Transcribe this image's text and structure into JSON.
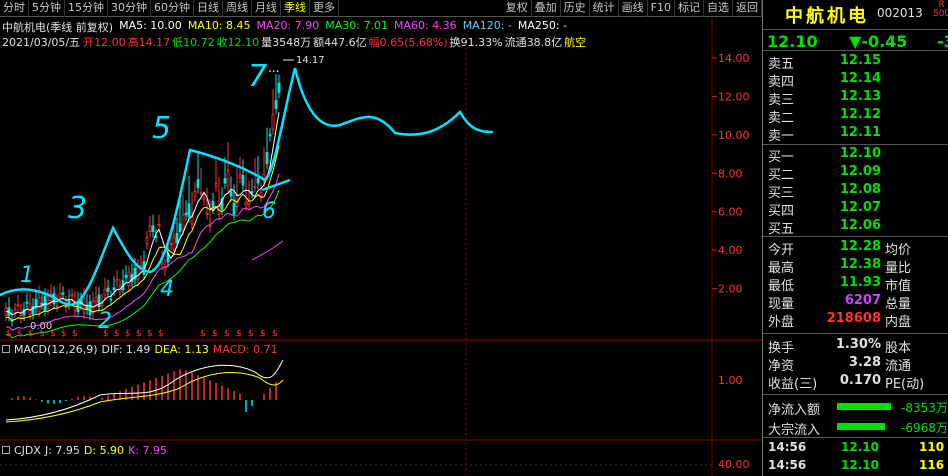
{
  "toolbar": {
    "left": [
      "分时",
      "5分钟",
      "15分钟",
      "30分钟",
      "60分钟",
      "日线",
      "周线",
      "月线",
      "季线",
      "更多"
    ],
    "active": "季线",
    "right": [
      "复权",
      "叠加",
      "历史",
      "统计",
      "画线",
      "F10",
      "标记",
      "自选",
      "返回"
    ]
  },
  "info": {
    "name_mode": "中航机电(季线 前复权)",
    "ma": [
      {
        "label": "MA5: 10.00",
        "color": "#ffffff"
      },
      {
        "label": "MA10: 8.45",
        "color": "#ffff00"
      },
      {
        "label": "MA20: 7.90",
        "color": "#ff44ff"
      },
      {
        "label": "MA30: 7.01",
        "color": "#00ff00"
      },
      {
        "label": "MA60: 4.36",
        "color": "#ff40ff"
      },
      {
        "label": "MA120: -",
        "color": "#66ccff"
      },
      {
        "label": "MA250: -",
        "color": "#ffffff"
      }
    ],
    "date": "2021/03/05/五",
    "fields": [
      {
        "label": "开",
        "value": "12.00",
        "label_color": "#ff3333",
        "value_color": "#ff3333"
      },
      {
        "label": "高",
        "value": "14.17",
        "label_color": "#ff3333",
        "value_color": "#ff3333"
      },
      {
        "label": "低",
        "value": "10.72",
        "label_color": "#00e000",
        "value_color": "#00e000"
      },
      {
        "label": "收",
        "value": "12.10",
        "label_color": "#00e000",
        "value_color": "#00e000"
      },
      {
        "label": "量",
        "value": "3548万",
        "label_color": "#e0e0e0",
        "value_color": "#e0e0e0"
      },
      {
        "label": "额",
        "value": "447.6亿",
        "label_color": "#e0e0e0",
        "value_color": "#e0e0e0"
      },
      {
        "label": "幅",
        "value": "0.65(5.68%)",
        "label_color": "#ff3333",
        "value_color": "#ff3333"
      },
      {
        "label": "换",
        "value": "91.33%",
        "label_color": "#e0e0e0",
        "value_color": "#e0e0e0"
      },
      {
        "label": "流通",
        "value": "38.8亿",
        "label_color": "#e0e0e0",
        "value_color": "#e0e0e0"
      },
      {
        "label": "",
        "value": "航空",
        "label_color": "#ffff00",
        "value_color": "#ffff00"
      }
    ]
  },
  "chart": {
    "high_label": "14.17",
    "low_label": "0.00",
    "y_ticks": [
      "14.00",
      "12.00",
      "10.00",
      "8.00",
      "6.00",
      "4.00",
      "2.00"
    ],
    "annotations": [
      "1",
      "2",
      "3",
      "4",
      "5",
      "6",
      "7"
    ]
  },
  "macd": {
    "name": "MACD(12,26,9)",
    "dif": "DIF: 1.49",
    "dea": "DEA: 1.13",
    "macd": "MACD: 0.71",
    "tick": "1.00"
  },
  "cjdx": {
    "name": "CJDX",
    "j": "J: 7.95",
    "d": "D: 5.90",
    "k": "K: 7.95",
    "tick": "40.00"
  },
  "quote": {
    "name": "中航机电",
    "code": "002013",
    "badge_r": "R",
    "badge_n": "500",
    "price": "12.10",
    "change": "▼-0.45",
    "change_pct": "-3",
    "asks": [
      {
        "label": "卖五",
        "price": "12.15"
      },
      {
        "label": "卖四",
        "price": "12.14"
      },
      {
        "label": "卖三",
        "price": "12.13"
      },
      {
        "label": "卖二",
        "price": "12.12"
      },
      {
        "label": "卖一",
        "price": "12.11"
      }
    ],
    "bids": [
      {
        "label": "买一",
        "price": "12.10"
      },
      {
        "label": "买二",
        "price": "12.09"
      },
      {
        "label": "买三",
        "price": "12.08"
      },
      {
        "label": "买四",
        "price": "12.07"
      },
      {
        "label": "买五",
        "price": "12.06"
      }
    ],
    "stats": [
      {
        "label": "今开",
        "value": "12.28",
        "color": "#00e000",
        "label2": "均价"
      },
      {
        "label": "最高",
        "value": "12.38",
        "color": "#00e000",
        "label2": "量比"
      },
      {
        "label": "最低",
        "value": "11.93",
        "color": "#00e000",
        "label2": "市值"
      },
      {
        "label": "现量",
        "value": "6207",
        "color": "#cc44ff",
        "label2": "总量"
      },
      {
        "label": "外盘",
        "value": "218608",
        "color": "#ff3333",
        "label2": "内盘"
      }
    ],
    "stats2": [
      {
        "label": "换手",
        "value": "1.30%",
        "color": "#e0e0e0",
        "label2": "股本"
      },
      {
        "label": "净资",
        "value": "3.28",
        "color": "#e0e0e0",
        "label2": "流通"
      },
      {
        "label": "收益(三)",
        "value": "0.170",
        "color": "#e0e0e0",
        "label2": "PE(动)"
      }
    ],
    "flows": [
      {
        "label": "净流入额",
        "value": "-8353万",
        "bar": 0.9
      },
      {
        "label": "大宗流入",
        "value": "-6968万",
        "bar": 0.8
      }
    ],
    "ticks": [
      {
        "time": "14:56",
        "price": "12.10",
        "vol": "110"
      },
      {
        "time": "14:56",
        "price": "12.10",
        "vol": "116"
      }
    ]
  }
}
